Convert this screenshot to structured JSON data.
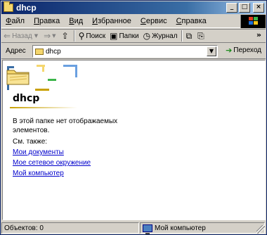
{
  "window": {
    "title": "dhcp",
    "controls": {
      "minimize": "_",
      "maximize": "□",
      "close": "×"
    }
  },
  "menubar": {
    "items": [
      {
        "label": "Файл"
      },
      {
        "label": "Правка"
      },
      {
        "label": "Вид"
      },
      {
        "label": "Избранное"
      },
      {
        "label": "Сервис"
      },
      {
        "label": "Справка"
      }
    ]
  },
  "toolbar": {
    "back_label": "Назад",
    "search_label": "Поиск",
    "folders_label": "Папки",
    "history_label": "Журнал",
    "overflow": "»"
  },
  "addressbar": {
    "label": "Адрес",
    "value": "dhcp",
    "go_label": "Переход"
  },
  "content": {
    "folder_title": "dhcp",
    "message": "В этой папке нет отображаемых элементов.",
    "see_also": "См. также:",
    "links": [
      {
        "label": "Мои документы"
      },
      {
        "label": "Мое сетевое окружение"
      },
      {
        "label": "Мой компьютер"
      }
    ]
  },
  "statusbar": {
    "objects": "Объектов: 0",
    "location": "Мой компьютер"
  },
  "colors": {
    "titlebar": "#0a246a",
    "link": "#0000cc",
    "chrome": "#d4d0c8"
  },
  "icons": [
    "folder-icon",
    "back-arrow-icon",
    "forward-arrow-icon",
    "up-folder-icon",
    "search-icon",
    "folders-icon",
    "history-icon",
    "go-icon",
    "computer-icon",
    "windows-logo-icon"
  ]
}
